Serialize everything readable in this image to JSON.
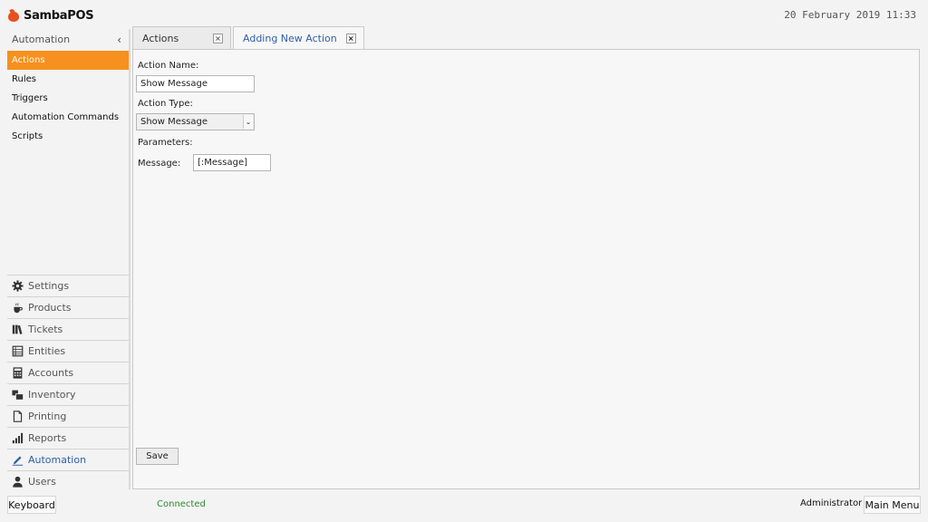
{
  "app": {
    "name": "SambaPOS",
    "datetime": "20 February 2019 11:33"
  },
  "sidebar": {
    "header": "Automation",
    "collapse_icon": "‹",
    "items": [
      {
        "label": "Actions",
        "active": true
      },
      {
        "label": "Rules"
      },
      {
        "label": "Triggers"
      },
      {
        "label": "Automation Commands"
      },
      {
        "label": "Scripts"
      }
    ]
  },
  "nav": {
    "items": [
      {
        "label": "Settings",
        "icon": "gear-icon"
      },
      {
        "label": "Products",
        "icon": "coffee-cup-icon"
      },
      {
        "label": "Tickets",
        "icon": "books-icon"
      },
      {
        "label": "Entities",
        "icon": "table-icon"
      },
      {
        "label": "Accounts",
        "icon": "calculator-icon"
      },
      {
        "label": "Inventory",
        "icon": "boxes-icon"
      },
      {
        "label": "Printing",
        "icon": "document-icon"
      },
      {
        "label": "Reports",
        "icon": "bar-chart-icon"
      },
      {
        "label": "Automation",
        "icon": "pencil-icon",
        "current": true
      },
      {
        "label": "Users",
        "icon": "user-icon"
      }
    ]
  },
  "tabs": [
    {
      "label": "Actions",
      "close": "×"
    },
    {
      "label": "Adding New Action",
      "close": "×",
      "active": true
    }
  ],
  "form": {
    "action_name_label": "Action Name:",
    "action_name_value": "Show Message",
    "action_type_label": "Action Type:",
    "action_type_value": "Show Message",
    "select_arrow": "⌄",
    "parameters_label": "Parameters:",
    "message_label": "Message:",
    "message_value": "[:Message]",
    "save_label": "Save"
  },
  "status": {
    "keyboard_label": "Keyboard",
    "connection": "Connected",
    "user": "Administrator",
    "main_menu_label": "Main Menu"
  },
  "colors": {
    "accent": "#f7901e",
    "link": "#2f5ea8",
    "connected": "#2e8b2e",
    "logo": "#e8501f"
  }
}
